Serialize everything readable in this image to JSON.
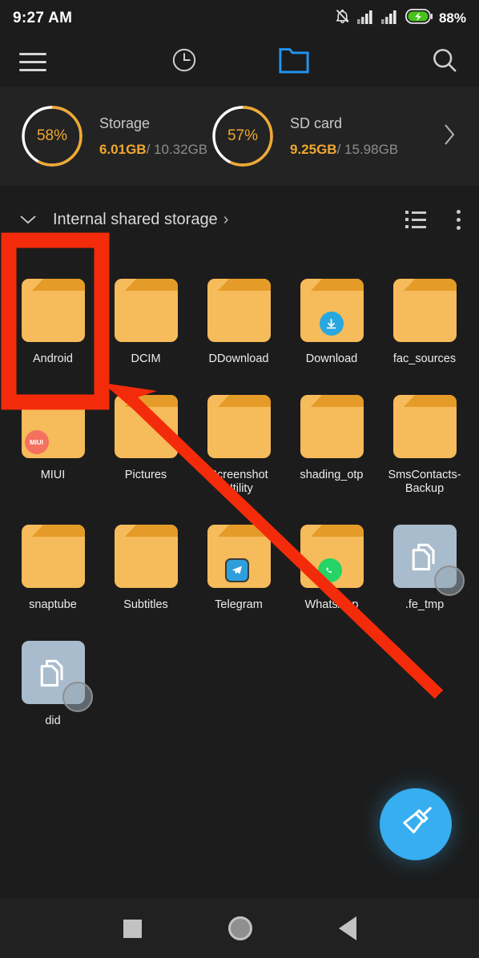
{
  "status_bar": {
    "time": "9:27 AM",
    "battery_percent": "88%",
    "icons": [
      "bell-mute-icon",
      "signal-bars-icon",
      "signal-bars-icon",
      "battery-charging-icon"
    ]
  },
  "toolbar": {
    "menu_icon": "hamburger-menu-icon",
    "recent_icon": "clock-history-icon",
    "files_icon": "folder-tab-icon",
    "search_icon": "search-icon",
    "active_tab": "files"
  },
  "storage": {
    "chevron": "chevron-right-icon",
    "cards": [
      {
        "title": "Storage",
        "percent_label": "58%",
        "percent": 58,
        "used": "6.01GB",
        "total": "/ 10.32GB"
      },
      {
        "title": "SD card",
        "percent_label": "57%",
        "percent": 57,
        "used": "9.25GB",
        "total": "/ 15.98GB"
      }
    ]
  },
  "pathbar": {
    "caret_icon": "chevron-down-icon",
    "label": "Internal shared storage",
    "separator": "›",
    "list_view_icon": "list-view-icon",
    "overflow_icon": "more-vertical-icon"
  },
  "grid": {
    "items": [
      {
        "name": "Android",
        "type": "folder",
        "badge": null
      },
      {
        "name": "DCIM",
        "type": "folder",
        "badge": null
      },
      {
        "name": "DDownload",
        "type": "folder",
        "badge": null
      },
      {
        "name": "Download",
        "type": "folder",
        "badge": "download-badge-icon"
      },
      {
        "name": "fac_sources",
        "type": "folder",
        "badge": null
      },
      {
        "name": "MIUI",
        "type": "folder",
        "badge": "miui-badge-icon",
        "badge_text": "MIUI"
      },
      {
        "name": "Pictures",
        "type": "folder",
        "badge": null
      },
      {
        "name": "Screenshot Utility",
        "type": "folder",
        "badge": null
      },
      {
        "name": "shading_otp",
        "type": "folder",
        "badge": null
      },
      {
        "name": "SmsContacts-Backup",
        "type": "folder",
        "badge": null
      },
      {
        "name": "snaptube",
        "type": "folder",
        "badge": null
      },
      {
        "name": "Subtitles",
        "type": "folder",
        "badge": null
      },
      {
        "name": "Telegram",
        "type": "folder",
        "badge": "telegram-badge-icon"
      },
      {
        "name": "WhatsApp",
        "type": "folder",
        "badge": "whatsapp-badge-icon"
      },
      {
        "name": ".fe_tmp",
        "type": "file",
        "badge": null
      },
      {
        "name": "did",
        "type": "file",
        "badge": null
      }
    ]
  },
  "fab": {
    "icon": "broom-clean-icon",
    "color": "#36aef0"
  },
  "navbar": {
    "recents_icon": "square-recents-icon",
    "home_icon": "circle-home-icon",
    "back_icon": "triangle-back-icon"
  },
  "annotation": {
    "color": "#f42b0a",
    "highlight_label": "Android",
    "shapes": [
      "highlight-rectangle",
      "pointer-arrow"
    ]
  },
  "colors": {
    "background": "#1c1c1c",
    "panel": "#232323",
    "accent_orange": "#f0a830",
    "folder": "#f6bb5a",
    "folder_tab": "#e59b28",
    "file_tile": "#a9bccd",
    "annotation_red": "#f42b0a",
    "fab_blue": "#36aef0"
  }
}
